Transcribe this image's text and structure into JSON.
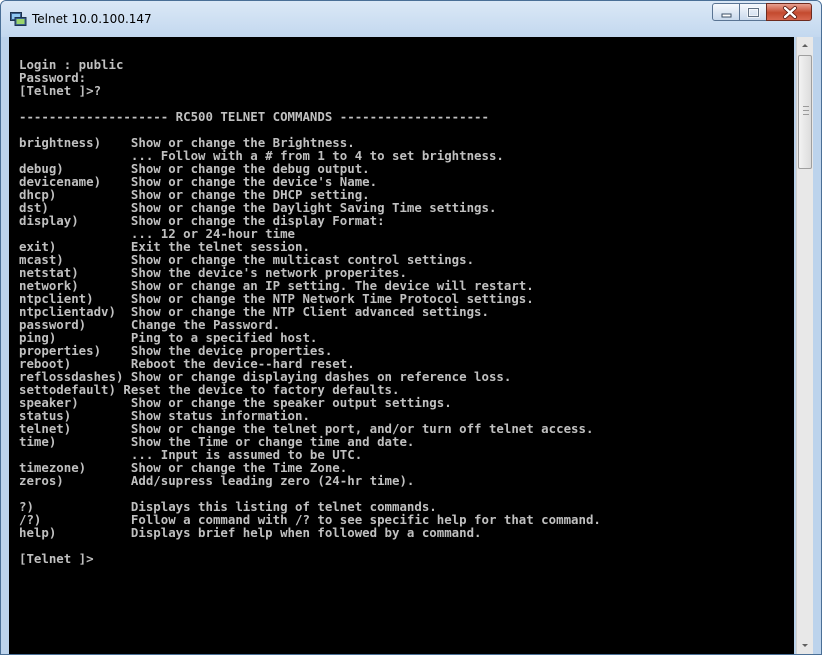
{
  "window": {
    "title": "Telnet 10.0.100.147",
    "controls": [
      "minimize",
      "maximize",
      "close"
    ]
  },
  "console": {
    "lines": [
      "Login : public",
      "Password:",
      "[Telnet ]>?",
      "",
      "-------------------- RC500 TELNET COMMANDS --------------------",
      "",
      "brightness)    Show or change the Brightness.",
      "               ... Follow with a # from 1 to 4 to set brightness.",
      "debug)         Show or change the debug output.",
      "devicename)    Show or change the device's Name.",
      "dhcp)          Show or change the DHCP setting.",
      "dst)           Show or change the Daylight Saving Time settings.",
      "display)       Show or change the display Format:",
      "               ... 12 or 24-hour time",
      "exit)          Exit the telnet session.",
      "mcast)         Show or change the multicast control settings.",
      "netstat)       Show the device's network properites.",
      "network)       Show or change an IP setting. The device will restart.",
      "ntpclient)     Show or change the NTP Network Time Protocol settings.",
      "ntpclientadv)  Show or change the NTP Client advanced settings.",
      "password)      Change the Password.",
      "ping)          Ping to a specified host.",
      "properties)    Show the device properties.",
      "reboot)        Reboot the device--hard reset.",
      "reflossdashes) Show or change displaying dashes on reference loss.",
      "settodefault) Reset the device to factory defaults.",
      "speaker)       Show or change the speaker output settings.",
      "status)        Show status information.",
      "telnet)        Show or change the telnet port, and/or turn off telnet access.",
      "time)          Show the Time or change time and date.",
      "               ... Input is assumed to be UTC.",
      "timezone)      Show or change the Time Zone.",
      "zeros)         Add/supress leading zero (24-hr time).",
      "",
      "?)             Displays this listing of telnet commands.",
      "/?)            Follow a command with /? to see specific help for that command.",
      "help)          Displays brief help when followed by a command.",
      "",
      "[Telnet ]>"
    ]
  },
  "icons": {
    "app": "telnet-terminal-icon",
    "minimize": "minimize-icon",
    "maximize": "maximize-icon",
    "close": "close-icon",
    "scroll_up": "chevron-up-icon",
    "scroll_down": "chevron-down-icon"
  },
  "colors": {
    "console_bg": "#000000",
    "console_text": "#c0c0c0",
    "titlebar": "#c3d8ef",
    "close_button": "#c44a2f"
  }
}
